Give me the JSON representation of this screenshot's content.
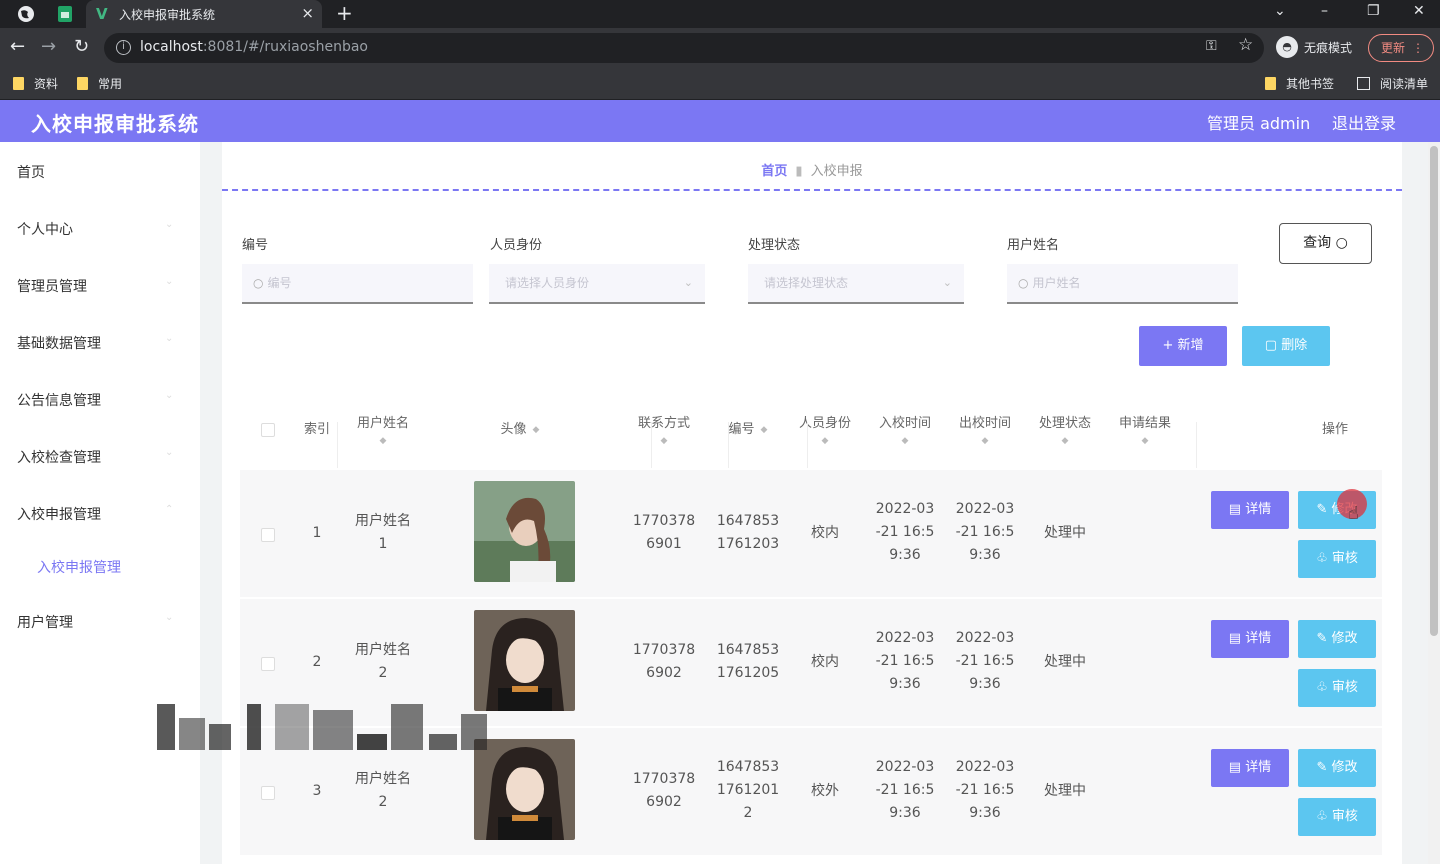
{
  "browser": {
    "tab_title": "入校申报审批系统",
    "url_host": "localhost",
    "url_path": ":8081/#/ruxiaoshenbao",
    "incognito_label": "无痕模式",
    "update_label": "更新",
    "bookmarks": [
      "资料",
      "常用"
    ],
    "bookmarks_right": [
      "其他书签",
      "阅读清单"
    ]
  },
  "header": {
    "title": "入校申报审批系统",
    "admin_label": "管理员 admin",
    "logout_label": "退出登录",
    "accent_color": "#7b77f3"
  },
  "sidebar": {
    "items": [
      {
        "label": "首页"
      },
      {
        "label": "个人中心"
      },
      {
        "label": "管理员管理"
      },
      {
        "label": "基础数据管理"
      },
      {
        "label": "公告信息管理"
      },
      {
        "label": "入校检查管理"
      },
      {
        "label": "入校申报管理"
      },
      {
        "label": "入校申报管理"
      },
      {
        "label": "用户管理"
      }
    ]
  },
  "breadcrumb": {
    "home": "首页",
    "current": "入校申报"
  },
  "filters": {
    "number_label": "编号",
    "number_placeholder": "编号",
    "identity_label": "人员身份",
    "identity_placeholder": "请选择人员身份",
    "status_label": "处理状态",
    "status_placeholder": "请选择处理状态",
    "username_label": "用户姓名",
    "username_placeholder": "用户姓名",
    "query_label": "查询"
  },
  "actions": {
    "add_label": "+ 新增",
    "delete_label": "删除"
  },
  "table": {
    "headers": {
      "index": "索引",
      "username": "用户姓名",
      "avatar": "头像",
      "phone": "联系方式",
      "number": "编号",
      "identity": "人员身份",
      "entry_time": "入校时间",
      "exit_time": "出校时间",
      "status": "处理状态",
      "result": "申请结果",
      "operation": "操作"
    },
    "rows": [
      {
        "index": "1",
        "username_a": "用户姓名",
        "username_b": "1",
        "phone_a": "1770378",
        "phone_b": "6901",
        "number_a": "1647853",
        "number_b": "1761203",
        "number_c": "",
        "identity": "校内",
        "entry_a": "2022-03",
        "entry_b": "-21 16:5",
        "entry_c": "9:36",
        "exit_a": "2022-03",
        "exit_b": "-21 16:5",
        "exit_c": "9:36",
        "status": "处理中",
        "result": "",
        "detail": "详情",
        "edit": "修改",
        "audit": "审核"
      },
      {
        "index": "2",
        "username_a": "用户姓名",
        "username_b": "2",
        "phone_a": "1770378",
        "phone_b": "6902",
        "number_a": "1647853",
        "number_b": "1761205",
        "number_c": "",
        "identity": "校内",
        "entry_a": "2022-03",
        "entry_b": "-21 16:5",
        "entry_c": "9:36",
        "exit_a": "2022-03",
        "exit_b": "-21 16:5",
        "exit_c": "9:36",
        "status": "处理中",
        "result": "",
        "detail": "详情",
        "edit": "修改",
        "audit": "审核"
      },
      {
        "index": "3",
        "username_a": "用户姓名",
        "username_b": "2",
        "phone_a": "1770378",
        "phone_b": "6902",
        "number_a": "1647853",
        "number_b": "1761201",
        "number_c": "2",
        "identity": "校外",
        "entry_a": "2022-03",
        "entry_b": "-21 16:5",
        "entry_c": "9:36",
        "exit_a": "2022-03",
        "exit_b": "-21 16:5",
        "exit_c": "9:36",
        "status": "处理中",
        "result": "",
        "detail": "详情",
        "edit": "修改",
        "audit": "审核"
      }
    ]
  }
}
